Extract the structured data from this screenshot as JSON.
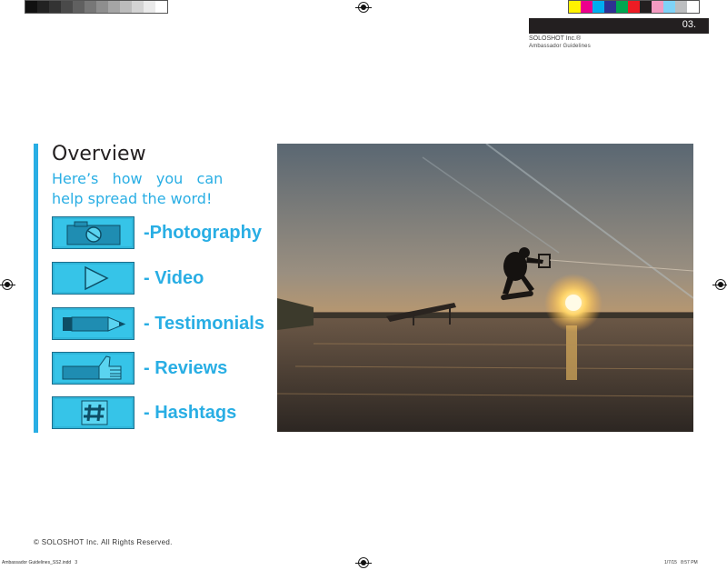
{
  "header": {
    "page_number": "03.",
    "company": "SOLOSHOT Inc.®",
    "doc_title": "Ambassador Guidelines"
  },
  "content": {
    "title": "Overview",
    "subtitle_line1": "Here’s   how   you   can",
    "subtitle_line2": "help spread the word!",
    "items": [
      {
        "label": "-Photography",
        "icon": "camera-icon"
      },
      {
        "label": "- Video",
        "icon": "play-icon"
      },
      {
        "label": "- Testimonials",
        "icon": "pencil-icon"
      },
      {
        "label": "- Reviews",
        "icon": "thumbs-up-icon"
      },
      {
        "label": "- Hashtags",
        "icon": "hashtag-icon"
      }
    ]
  },
  "footer": {
    "copyright": "© SOLOSHOT Inc. All Rights Reserved.",
    "slug_left": "Ambassador Guidelines_SS2.indd   3",
    "slug_right": "1/7/15   8:57 PM"
  },
  "colors": {
    "accent": "#29aee4",
    "button": "#36c4e8",
    "dark": "#231f20"
  }
}
